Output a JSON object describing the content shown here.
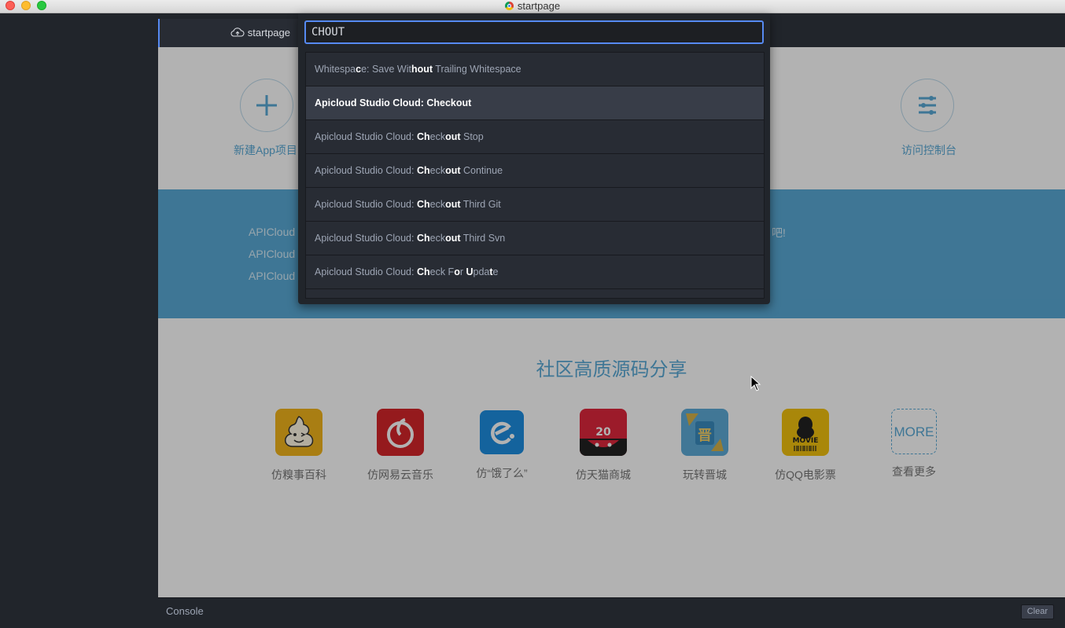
{
  "window": {
    "title": "startpage"
  },
  "tab": {
    "label": "startpage",
    "icon": "cloud-upload-icon"
  },
  "palette": {
    "query": "CHOUT",
    "items": [
      {
        "segments": [
          [
            "Whitespa",
            0
          ],
          [
            "c",
            1
          ],
          [
            "e: Save Wit",
            0
          ],
          [
            "hout",
            1
          ],
          [
            " Trailing Whitespace",
            0
          ]
        ],
        "selected": false
      },
      {
        "segments": [
          [
            "Apicloud Studio Cloud: Checkout",
            1
          ]
        ],
        "selected": true
      },
      {
        "segments": [
          [
            "Apicloud Studio Cloud: ",
            0
          ],
          [
            "Ch",
            1
          ],
          [
            "eck",
            0
          ],
          [
            "out",
            1
          ],
          [
            " Stop",
            0
          ]
        ],
        "selected": false
      },
      {
        "segments": [
          [
            "Apicloud Studio Cloud: ",
            0
          ],
          [
            "Ch",
            1
          ],
          [
            "eck",
            0
          ],
          [
            "out",
            1
          ],
          [
            " Continue",
            0
          ]
        ],
        "selected": false
      },
      {
        "segments": [
          [
            "Apicloud Studio Cloud: ",
            0
          ],
          [
            "Ch",
            1
          ],
          [
            "eck",
            0
          ],
          [
            "out",
            1
          ],
          [
            " Third Git",
            0
          ]
        ],
        "selected": false
      },
      {
        "segments": [
          [
            "Apicloud Studio Cloud: ",
            0
          ],
          [
            "Ch",
            1
          ],
          [
            "eck",
            0
          ],
          [
            "out",
            1
          ],
          [
            " Third Svn",
            0
          ]
        ],
        "selected": false
      },
      {
        "segments": [
          [
            "Apicloud Studio Cloud: ",
            0
          ],
          [
            "Ch",
            1
          ],
          [
            "eck F",
            0
          ],
          [
            "o",
            1
          ],
          [
            "r ",
            0
          ],
          [
            "U",
            1
          ],
          [
            "pda",
            0
          ],
          [
            "t",
            1
          ],
          [
            "e",
            0
          ]
        ],
        "selected": false
      }
    ]
  },
  "page": {
    "new_app_label": "新建App项目",
    "console_label": "访问控制台",
    "band_lines": [
      "APICloud",
      "APICloud",
      "APICloud"
    ],
    "band_tail": "吧!",
    "section_title": "社区高质源码分享",
    "apps": [
      {
        "label": "仿糗事百科",
        "icon": "poop-emoji-icon",
        "color": "#f2b51c"
      },
      {
        "label": "仿网易云音乐",
        "icon": "netease-music-icon",
        "color": "#d6262a"
      },
      {
        "label": "仿“饿了么”",
        "icon": "eleme-icon",
        "color": "#1e8fe1"
      },
      {
        "label": "仿天猫商城",
        "icon": "tmall-icon",
        "color": "#e0283d"
      },
      {
        "label": "玩转晋城",
        "icon": "jin-character-icon",
        "color": "#5dabd7"
      },
      {
        "label": "仿QQ电影票",
        "icon": "qq-movie-icon",
        "color": "#f3c20f"
      },
      {
        "label": "查看更多",
        "icon": "more-icon",
        "more_text": "MORE"
      }
    ]
  },
  "console": {
    "label": "Console",
    "clear_label": "Clear"
  },
  "colors": {
    "accent": "#568af2",
    "brand_blue": "#5aa9d6"
  }
}
